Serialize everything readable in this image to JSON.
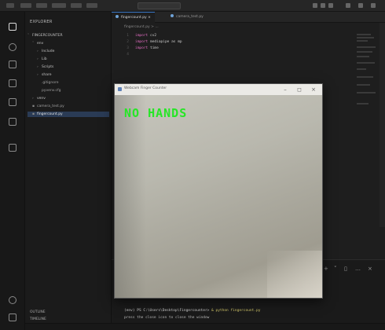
{
  "colors": {
    "overlay_green": "#26e626",
    "selection_blue": "#2a3b55",
    "keyword_pink": "#e06cc0"
  },
  "titlebar": {
    "icons": [
      "minimize-icon",
      "maximize-icon",
      "close-icon"
    ]
  },
  "activity_bar": {
    "icons": [
      "files-icon",
      "search-icon",
      "source-control-icon",
      "run-debug-icon",
      "extensions-icon",
      "testing-icon",
      "remote-icon",
      "account-icon"
    ]
  },
  "sidebar": {
    "header": "EXPLORER",
    "project": "FINGERCOUNTER",
    "items": [
      {
        "label": "env",
        "folder": true
      },
      {
        "label": "Include",
        "folder": true
      },
      {
        "label": "Lib",
        "folder": true
      },
      {
        "label": "Scripts",
        "folder": true
      },
      {
        "label": "share",
        "folder": true
      },
      {
        "label": ".gitignore",
        "folder": false
      },
      {
        "label": "pyvenv.cfg",
        "folder": false
      },
      {
        "label": "venv",
        "folder": true
      },
      {
        "label": "camera_test.py",
        "folder": false
      },
      {
        "label": "fingercount.py",
        "folder": false
      }
    ],
    "bottom": [
      "OUTLINE",
      "TIMELINE"
    ]
  },
  "editor": {
    "tabs": [
      "fingercount.py",
      "camera_test.py"
    ],
    "breadcrumb": "fingercount.py > ...",
    "lines": [
      {
        "n": "1",
        "kw": "import",
        "id": "cv2"
      },
      {
        "n": "2",
        "kw": "import",
        "id": "mediapipe as mp"
      },
      {
        "n": "3",
        "kw": "import",
        "id": "time"
      },
      {
        "n": "4",
        "kw": "",
        "id": ""
      }
    ]
  },
  "window": {
    "title": "Webcam Finger Counter",
    "overlay_text": "NO HANDS",
    "buttons": [
      "minimize-icon",
      "maximize-icon",
      "close-icon"
    ]
  },
  "panel": {
    "prompt_path": "(env) PS C:\\Users\\Desktop\\Fingercounter>",
    "command": "& python fingercount.py",
    "output": "press the close icon to close the window"
  }
}
